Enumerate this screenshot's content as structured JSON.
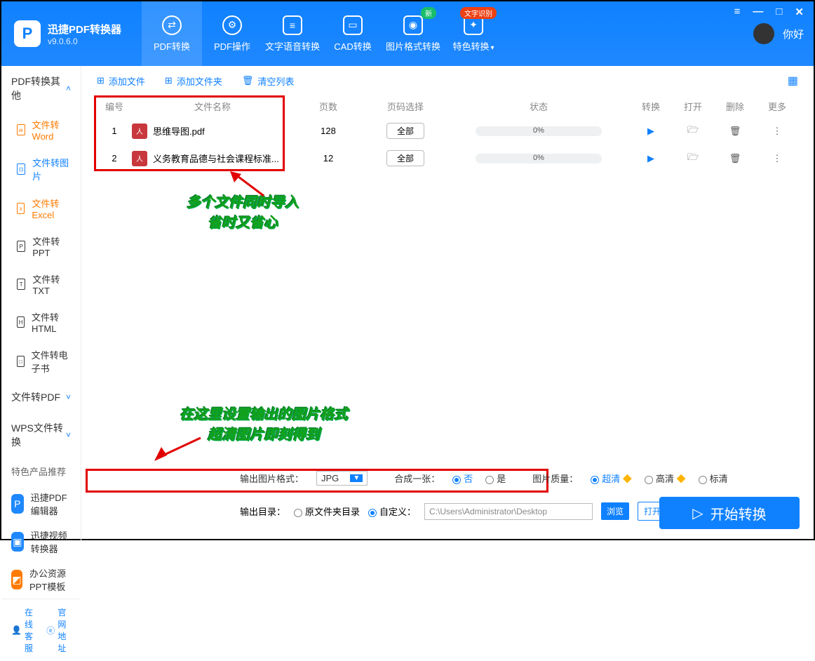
{
  "app": {
    "title": "迅捷PDF转换器",
    "version": "v9.0.6.0",
    "greeting": "你好"
  },
  "winbtns": {
    "menu": "≡",
    "min": "—",
    "max": "□",
    "close": "✕"
  },
  "tabs": [
    {
      "label": "PDF转换",
      "active": true
    },
    {
      "label": "PDF操作"
    },
    {
      "label": "文字语音转换"
    },
    {
      "label": "CAD转换"
    },
    {
      "label": "图片格式转换",
      "badge": "新",
      "badgeColor": "green"
    },
    {
      "label": "特色转换",
      "badge": "文字识别",
      "badgeColor": "red",
      "chevron": true
    }
  ],
  "sidebar": {
    "group1": {
      "title": "PDF转换其他",
      "expanded": true,
      "items": [
        {
          "label": "文件转Word",
          "glyph": "w",
          "active": true
        },
        {
          "label": "文件转图片",
          "glyph": "⊡",
          "active": true
        },
        {
          "label": "文件转Excel",
          "glyph": "x",
          "active": true
        },
        {
          "label": "文件转PPT",
          "glyph": "P"
        },
        {
          "label": "文件转TXT",
          "glyph": "T"
        },
        {
          "label": "文件转HTML",
          "glyph": "H"
        },
        {
          "label": "文件转电子书",
          "glyph": "□"
        }
      ]
    },
    "group2": {
      "title": "文件转PDF"
    },
    "group3": {
      "title": "WPS文件转换"
    },
    "promo_title": "特色产品推荐",
    "promos": [
      {
        "label": "迅捷PDF编辑器",
        "color": "#1f88ff",
        "glyph": "P"
      },
      {
        "label": "迅捷视频转换器",
        "color": "#1f88ff",
        "glyph": "▣"
      },
      {
        "label": "办公资源PPT模板",
        "color": "#ff7a00",
        "glyph": "◩"
      }
    ],
    "footer": {
      "service": "在线客服",
      "site": "官网地址"
    }
  },
  "toolbar": {
    "add_file": "添加文件",
    "add_folder": "添加文件夹",
    "clear": "清空列表"
  },
  "columns": {
    "idx": "编号",
    "name": "文件名称",
    "pages": "页数",
    "psel": "页码选择",
    "status": "状态",
    "convert": "转换",
    "open": "打开",
    "delete": "删除",
    "more": "更多"
  },
  "rows": [
    {
      "idx": "1",
      "name": "思维导图.pdf",
      "pages": "128",
      "psel": "全部",
      "status": "0%"
    },
    {
      "idx": "2",
      "name": "义务教育品德与社会课程标准...",
      "pages": "12",
      "psel": "全部",
      "status": "0%"
    }
  ],
  "annotations": {
    "a1_l1": "多个文件同时导入",
    "a1_l2": "省时又省心",
    "a2_l1": "在这里设置输出的图片格式",
    "a2_l2": "超清图片即刻得到"
  },
  "settings": {
    "fmt_label": "输出图片格式：",
    "fmt_value": "JPG",
    "merge_label": "合成一张：",
    "merge_no": "否",
    "merge_yes": "是",
    "quality_label": "图片质量：",
    "q_ultra": "超清",
    "q_hd": "高清",
    "q_std": "标清"
  },
  "output": {
    "dir_label": "输出目录：",
    "opt_src": "原文件夹目录",
    "opt_custom": "自定义：",
    "path": "C:\\Users\\Administrator\\Desktop",
    "browse": "浏览",
    "open_dir": "打开文件目录"
  },
  "start": "开始转换"
}
